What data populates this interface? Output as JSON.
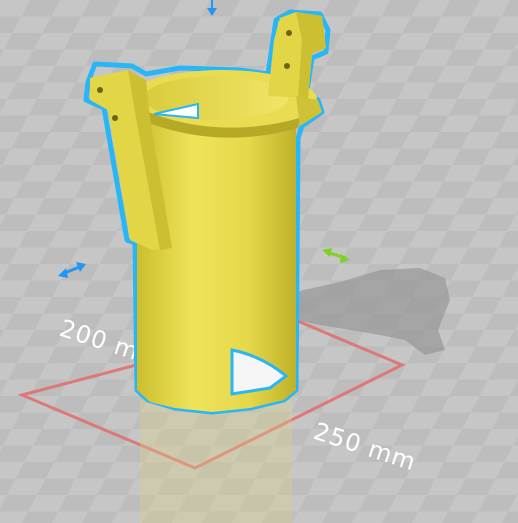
{
  "viewport": {
    "bed_width_label": "200 mm",
    "bed_depth_label": "250 mm"
  },
  "colors": {
    "background": "#b9b9b9",
    "grid_light": "#c3c3c3",
    "grid_dark": "#adadad",
    "model_fill": "#e6d94a",
    "model_shade": "#c9bb2d",
    "selection_outline": "#29b6f6",
    "bed_border": "#e07070",
    "arrow_blue": "#2196f3",
    "arrow_green": "#7ed321"
  },
  "icons": {
    "move_x": "double-arrow-horizontal-icon",
    "move_y": "double-arrow-diagonal-icon",
    "move_z": "arrow-down-icon"
  }
}
